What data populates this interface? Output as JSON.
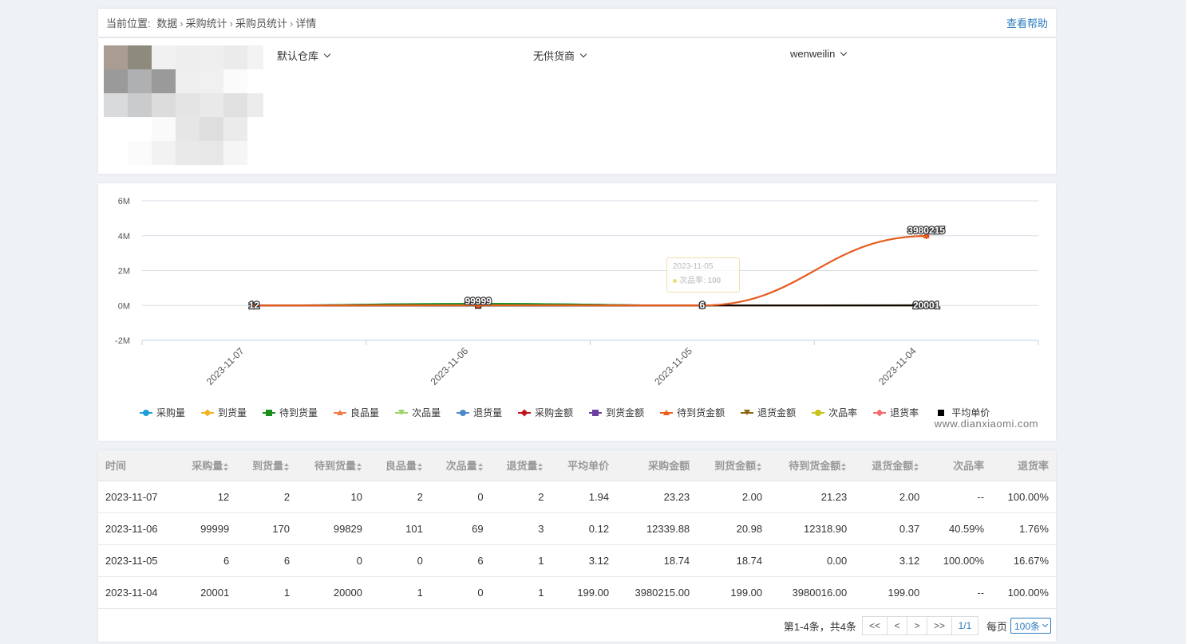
{
  "breadcrumb": {
    "prefix": "当前位置:",
    "items": [
      "数据",
      "采购统计",
      "采购员统计",
      "详情"
    ],
    "help": "查看帮助"
  },
  "filters": {
    "warehouse": "默认仓库",
    "supplier": "无供货商",
    "buyer": "wenweilin"
  },
  "colors": {
    "accent": "#2b7bbf",
    "line_orange": "#e8601c",
    "line_green": "#1b8f1b"
  },
  "chart_data": {
    "type": "line",
    "categories": [
      "2023-11-07",
      "2023-11-06",
      "2023-11-05",
      "2023-11-04"
    ],
    "y_ticks": [
      "6M",
      "4M",
      "2M",
      "0M",
      "-2M"
    ],
    "ylim": [
      -2000000,
      6000000
    ],
    "series": [
      {
        "name": "采购量",
        "color": "#1e9fd8",
        "marker": "circle",
        "values": [
          12,
          99999,
          6,
          20001
        ]
      },
      {
        "name": "到货量",
        "color": "#f0b31c",
        "marker": "diamond",
        "values": [
          2,
          170,
          6,
          1
        ]
      },
      {
        "name": "待到货量",
        "color": "#1b8f1b",
        "marker": "square",
        "values": [
          10,
          99829,
          0,
          20000
        ]
      },
      {
        "name": "良品量",
        "color": "#f07b46",
        "marker": "triangle",
        "values": [
          2,
          101,
          0,
          1
        ]
      },
      {
        "name": "次品量",
        "color": "#9ed36b",
        "marker": "triangle-down",
        "values": [
          0,
          69,
          6,
          0
        ]
      },
      {
        "name": "退货量",
        "color": "#4a8ac8",
        "marker": "circle",
        "values": [
          2,
          3,
          1,
          1
        ]
      },
      {
        "name": "采购金额",
        "color": "#c0141a",
        "marker": "diamond",
        "values": [
          23.23,
          12339.88,
          18.74,
          3980215.0
        ]
      },
      {
        "name": "到货金额",
        "color": "#6b3fa0",
        "marker": "square",
        "values": [
          2.0,
          20.98,
          18.74,
          199.0
        ]
      },
      {
        "name": "待到货金额",
        "color": "#e8601c",
        "marker": "triangle",
        "values": [
          21.23,
          12318.9,
          0.0,
          3980016.0
        ]
      },
      {
        "name": "退货金额",
        "color": "#8a6512",
        "marker": "triangle-down",
        "values": [
          2.0,
          0.37,
          3.12,
          199.0
        ]
      },
      {
        "name": "次品率",
        "color": "#c9c516",
        "marker": "circle",
        "values": [
          0,
          40.59,
          100,
          0
        ]
      },
      {
        "name": "退货率",
        "color": "#f56b6b",
        "marker": "diamond",
        "values": [
          100,
          1.76,
          16.67,
          100
        ]
      },
      {
        "name": "平均单价",
        "color": "#000000",
        "marker": "square",
        "values": [
          1.94,
          0.12,
          3.12,
          199.0
        ]
      }
    ],
    "data_labels": [
      "12",
      "99999",
      "6",
      "3980215",
      "20001"
    ],
    "legend_position": "bottom",
    "grid": true,
    "tooltip": {
      "date": "2023-11-05",
      "label": "次品率:",
      "value": "100"
    }
  },
  "watermark": "www.dianxiaomi.com",
  "table": {
    "columns": [
      {
        "label": "时间",
        "sortable": false
      },
      {
        "label": "采购量",
        "sortable": true
      },
      {
        "label": "到货量",
        "sortable": true
      },
      {
        "label": "待到货量",
        "sortable": true
      },
      {
        "label": "良品量",
        "sortable": true
      },
      {
        "label": "次品量",
        "sortable": true
      },
      {
        "label": "退货量",
        "sortable": true
      },
      {
        "label": "平均单价",
        "sortable": false
      },
      {
        "label": "采购金额",
        "sortable": false
      },
      {
        "label": "到货金额",
        "sortable": true
      },
      {
        "label": "待到货金额",
        "sortable": true
      },
      {
        "label": "退货金额",
        "sortable": true
      },
      {
        "label": "次品率",
        "sortable": false
      },
      {
        "label": "退货率",
        "sortable": false
      }
    ],
    "rows": [
      [
        "2023-11-07",
        "12",
        "2",
        "10",
        "2",
        "0",
        "2",
        "1.94",
        "23.23",
        "2.00",
        "21.23",
        "2.00",
        "--",
        "100.00%"
      ],
      [
        "2023-11-06",
        "99999",
        "170",
        "99829",
        "101",
        "69",
        "3",
        "0.12",
        "12339.88",
        "20.98",
        "12318.90",
        "0.37",
        "40.59%",
        "1.76%"
      ],
      [
        "2023-11-05",
        "6",
        "6",
        "0",
        "0",
        "6",
        "1",
        "3.12",
        "18.74",
        "18.74",
        "0.00",
        "3.12",
        "100.00%",
        "16.67%"
      ],
      [
        "2023-11-04",
        "20001",
        "1",
        "20000",
        "1",
        "0",
        "1",
        "199.00",
        "3980215.00",
        "199.00",
        "3980016.00",
        "199.00",
        "--",
        "100.00%"
      ]
    ]
  },
  "pagination": {
    "summary": "第1-4条，共4条",
    "first": "<<",
    "prev": "<",
    "next": ">",
    "last": ">>",
    "current": "1/1",
    "per_page_label": "每页",
    "per_page_value": "100条"
  }
}
